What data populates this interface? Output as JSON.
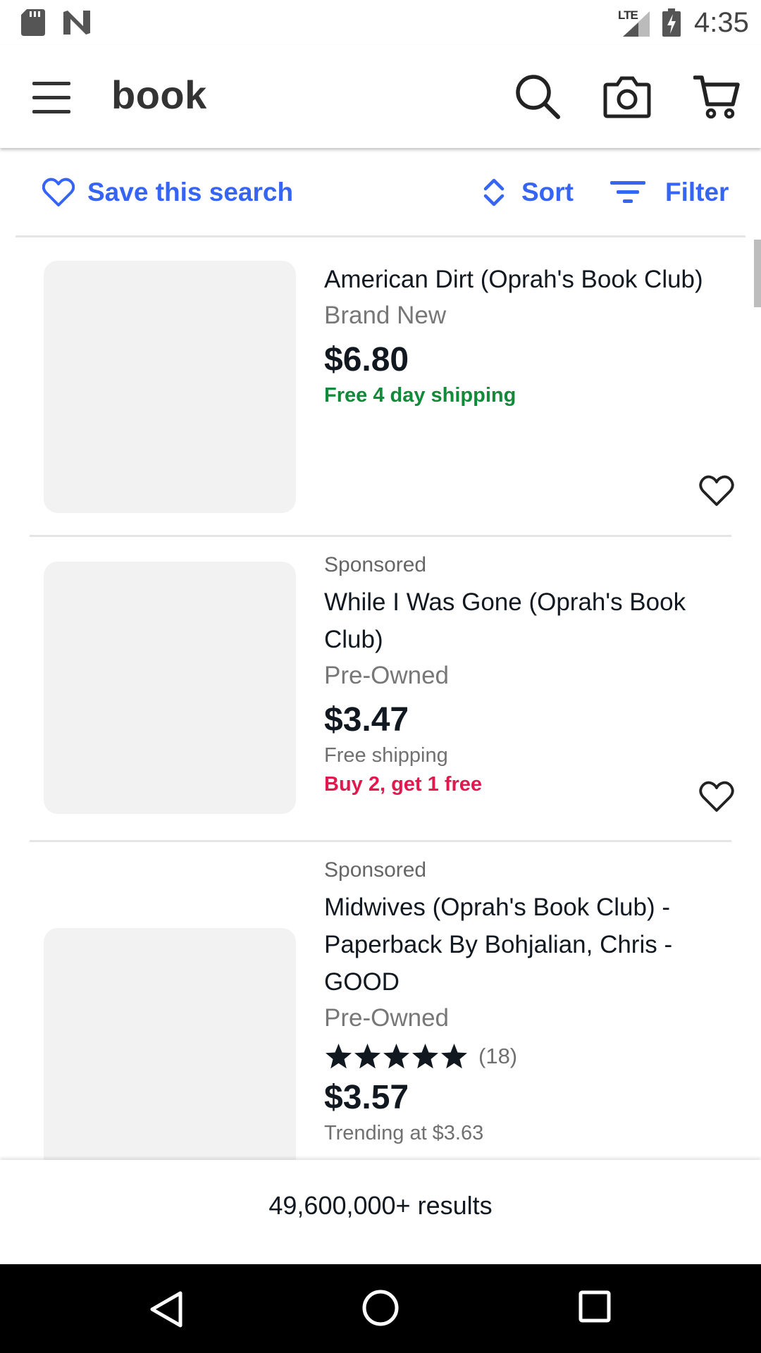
{
  "status_bar": {
    "network": "LTE",
    "time": "4:35"
  },
  "header": {
    "query": "book"
  },
  "actions": {
    "save_search": "Save this search",
    "sort": "Sort",
    "filter": "Filter"
  },
  "items": [
    {
      "sponsored": "",
      "title": "American Dirt (Oprah's Book Club)",
      "condition": "Brand New",
      "price": "$6.80",
      "shipping": "Free 4 day shipping"
    },
    {
      "sponsored": "Sponsored",
      "title": "While I Was Gone (Oprah's Book Club)",
      "condition": "Pre-Owned",
      "price": "$3.47",
      "shipping": "Free shipping",
      "promo": "Buy 2, get 1 free"
    },
    {
      "sponsored": "Sponsored",
      "title": "Midwives (Oprah's Book Club) - Paperback By Bohjalian, Chris - GOOD",
      "condition": "Pre-Owned",
      "rating_stars": 5,
      "rating_count": "(18)",
      "price": "$3.57",
      "trending": "Trending at $3.63"
    }
  ],
  "results": {
    "count": "49,600,000+ results"
  },
  "colors": {
    "link_blue": "#3665f3",
    "shipping_green": "#118a3a",
    "promo_red": "#e0194e"
  }
}
